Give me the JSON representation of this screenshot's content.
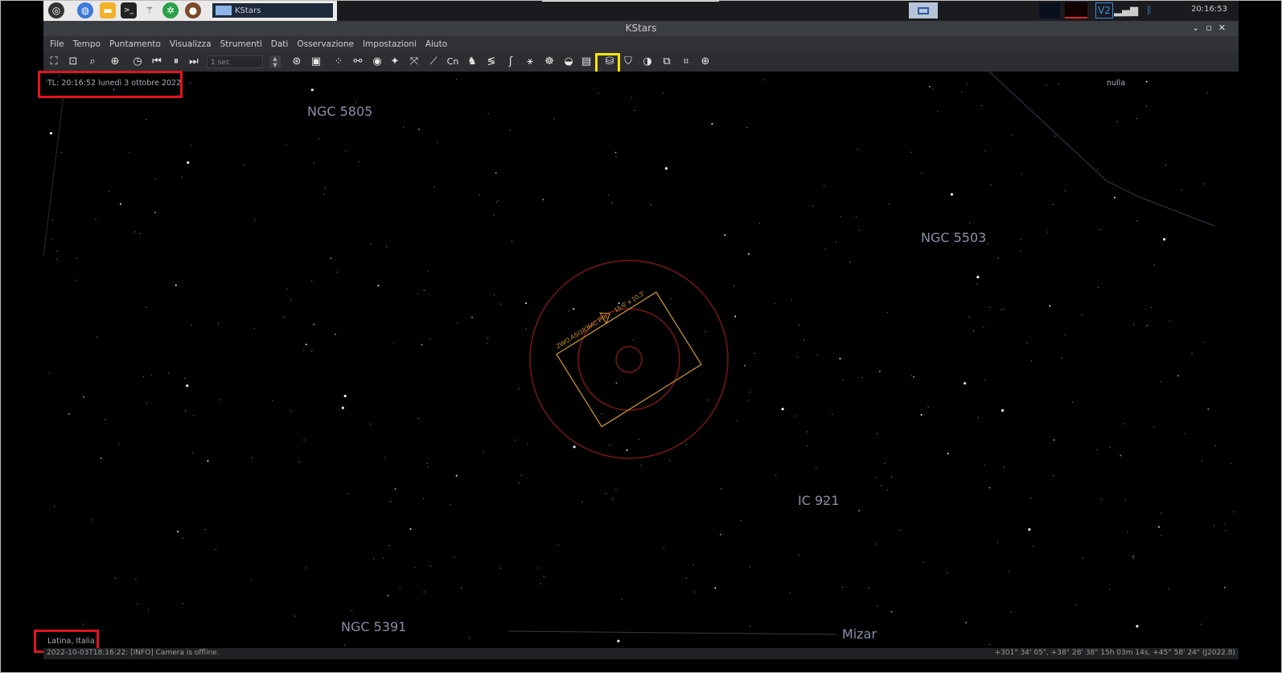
{
  "taskbar": {
    "task_label": "KStars",
    "clock": "20:16:53",
    "vnc_label": "V2",
    "colors": {
      "accent": "#8db4e8",
      "bluetooth": "#3a8ee6"
    }
  },
  "window": {
    "title": "KStars"
  },
  "menu": {
    "items": [
      "File",
      "Tempo",
      "Puntamento",
      "Visualizza",
      "Strumenti",
      "Dati",
      "Osservazione",
      "Impostazioni",
      "Aiuto"
    ]
  },
  "toolbar": {
    "speed_value": "1 sec"
  },
  "sky": {
    "time_info": "TL: 20:16:52   lunedì 3 ottobre 2022",
    "focus_info": "nulla",
    "location": "Latina, Italia",
    "labels": {
      "ngc5805": "NGC 5805",
      "ngc5503": "NGC 5503",
      "ic921": "IC 921",
      "ngc5391": "NGC 5391",
      "mizar": "Mizar"
    },
    "fov_label_1": "ZWO ASI183MC Pro",
    "fov_label_2": "15.3' x 10.3'",
    "colors": {
      "fov_rect": "#d49a2a",
      "circle": "#8a1a1a",
      "highlight_red": "#e0141e",
      "highlight_yellow": "#ffe600"
    }
  },
  "status": {
    "message": "2022-10-03T18:16:22: [INFO] Camera is offline.",
    "coords": "+301° 34' 05\", +38° 28' 38\"  15h 03m 14s, +45° 58' 24\" (J2022.8)"
  }
}
